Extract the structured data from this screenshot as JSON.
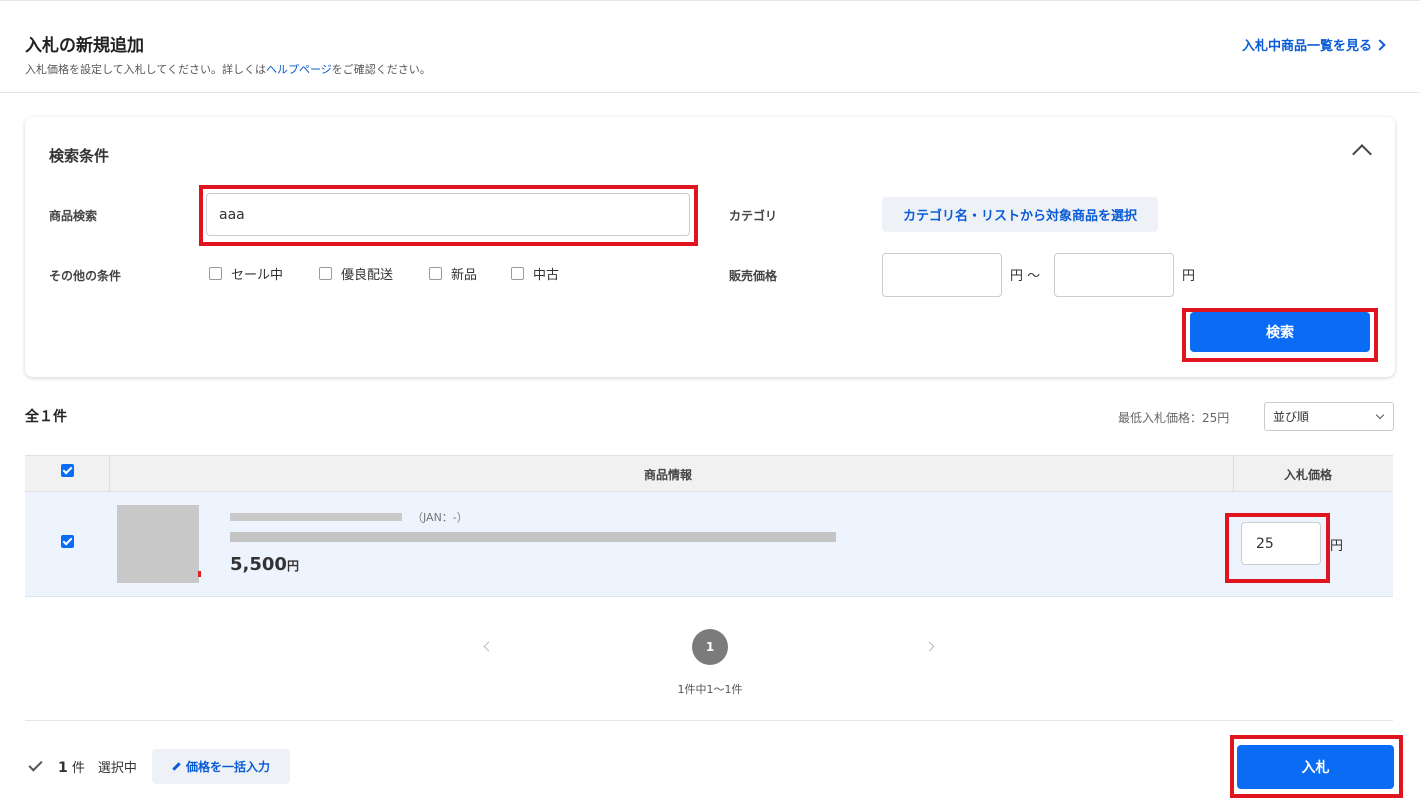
{
  "header": {
    "title": "入札の新規追加",
    "subtitle_before": "入札価格を設定して入札してください。詳しくは",
    "subtitle_link": "ヘルプページ",
    "subtitle_after": "をご確認ください。",
    "right_link": "入札中商品一覧を見る"
  },
  "search": {
    "title": "検索条件",
    "product_label": "商品検索",
    "product_value": "aaa",
    "category_label": "カテゴリ",
    "category_button": "カテゴリ名・リストから対象商品を選択",
    "other_label": "その他の条件",
    "options": [
      "セール中",
      "優良配送",
      "新品",
      "中古"
    ],
    "price_label": "販売価格",
    "price_min": "",
    "price_max": "",
    "yen_tilde": "円 ～",
    "yen": "円",
    "button": "検索"
  },
  "results": {
    "total": "全１件",
    "min_price": "最低入札価格：25円",
    "sort": "並び順"
  },
  "table": {
    "col_info": "商品情報",
    "col_price": "入札価格",
    "rows": [
      {
        "jan": "（JAN：-）",
        "price": "5,500",
        "price_unit": "円",
        "bid": "25",
        "bid_unit": "円"
      }
    ]
  },
  "pager": {
    "current": "1",
    "info": "1件中1〜1件"
  },
  "footer": {
    "count": "1",
    "count_suffix": " 件　選択中",
    "bulk_button": "価格を一括入力",
    "bid_button": "入札"
  },
  "colors": {
    "accent": "#0a6cf5",
    "link": "#0a5bd6",
    "highlight": "#e0141e"
  }
}
